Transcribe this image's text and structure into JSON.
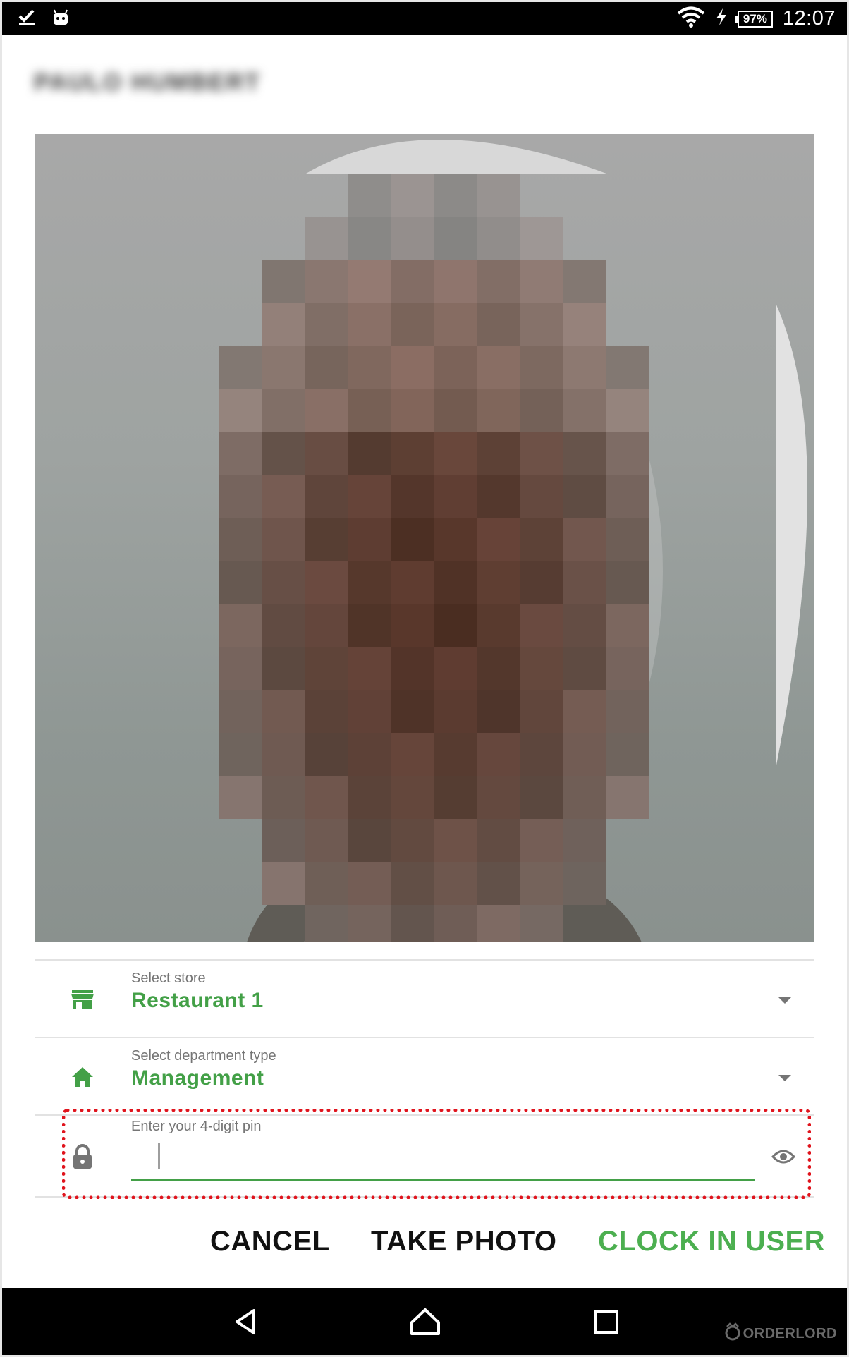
{
  "status_bar": {
    "battery": "97%",
    "time": "12:07"
  },
  "header": {
    "user_name": "PAULO HUMBERT"
  },
  "store": {
    "label": "Select store",
    "value": "Restaurant 1"
  },
  "department": {
    "label": "Select department type",
    "value": "Management"
  },
  "pin": {
    "label": "Enter your 4-digit pin",
    "value": ""
  },
  "actions": {
    "cancel": "CANCEL",
    "take_photo": "TAKE PHOTO",
    "clock_in": "CLOCK IN USER"
  },
  "branding": {
    "name": "ORDERLORD"
  },
  "colors": {
    "accent": "#43a047",
    "highlight_border": "#e0141d",
    "status_bar": "#000000"
  },
  "icons": [
    "check-icon",
    "android-icon",
    "wifi-icon",
    "charging-icon",
    "store-icon",
    "home-icon",
    "lock-icon",
    "eye-icon",
    "back-icon",
    "home-nav-icon",
    "recents-icon"
  ]
}
